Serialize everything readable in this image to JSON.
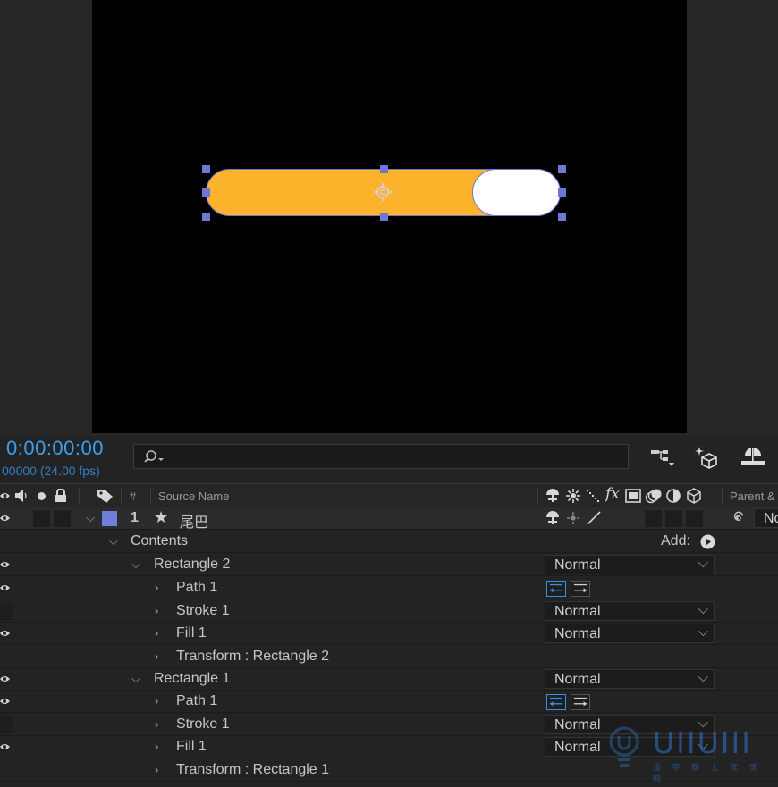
{
  "timeline": {
    "timecode": "0:00:00:00",
    "frame_info": "00000 (24.00 fps)",
    "search_placeholder": ""
  },
  "columns": {
    "number": "#",
    "source_name": "Source Name",
    "parent": "Parent &"
  },
  "layer": {
    "index": "1",
    "name": "尾巴",
    "label_color": "#6d7fd8",
    "parent_value": "No"
  },
  "contents": {
    "label": "Contents",
    "add_label": "Add:"
  },
  "groups": [
    {
      "name": "Rectangle 2",
      "blend": "Normal",
      "items": {
        "path": "Path 1",
        "stroke": "Stroke 1",
        "stroke_blend": "Normal",
        "fill": "Fill 1",
        "fill_blend": "Normal",
        "transform": "Transform : Rectangle 2"
      }
    },
    {
      "name": "Rectangle 1",
      "blend": "Normal",
      "items": {
        "path": "Path 1",
        "stroke": "Stroke 1",
        "stroke_blend": "Normal",
        "fill": "Fill 1",
        "fill_blend": "Normal",
        "transform": "Transform : Rectangle 1"
      }
    }
  ],
  "watermark": {
    "text": "UIIUIII",
    "subtext": "设 学 就 上 优 优 网"
  },
  "colors": {
    "pill_fill": "#fdb42c",
    "knob_fill": "#ffffff",
    "selection": "#6e76d8",
    "timecode": "#3aa0f0"
  }
}
